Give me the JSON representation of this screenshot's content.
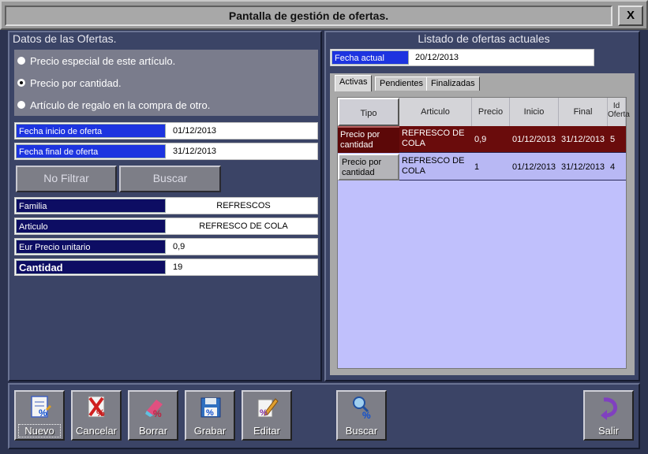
{
  "window": {
    "title": "Pantalla de gestión de ofertas.",
    "close_label": "X"
  },
  "left_panel": {
    "title": "Datos de las Ofertas.",
    "radios": [
      {
        "label": "Precio especial de este artículo.",
        "selected": false
      },
      {
        "label": "Precio por cantidad.",
        "selected": true
      },
      {
        "label": "Artículo de regalo en la compra de otro.",
        "selected": false
      }
    ],
    "fecha_inicio": {
      "label": "Fecha inicio de oferta",
      "value": "01/12/2013"
    },
    "fecha_final": {
      "label": "Fecha final de oferta",
      "value": "31/12/2013"
    },
    "btn_no_filtrar": "No Filtrar",
    "btn_buscar": "Buscar",
    "familia": {
      "label": "Familia",
      "value": "REFRESCOS"
    },
    "articulo": {
      "label": "Articulo",
      "value": "REFRESCO DE COLA"
    },
    "precio": {
      "label": "Eur Precio unitario",
      "value": "0,9"
    },
    "cantidad": {
      "label": "Cantidad",
      "value": "19"
    }
  },
  "right_panel": {
    "title": "Listado de ofertas actuales",
    "fecha_actual": {
      "label": "Fecha actual",
      "value": "20/12/2013"
    },
    "tabs": [
      "Activas",
      "Pendientes",
      "Finalizadas"
    ],
    "columns": [
      "Tipo",
      "Articulo",
      "Precio",
      "Inicio",
      "Final",
      "Id Oferta"
    ],
    "rows": [
      {
        "tipo": "Precio por cantidad",
        "articulo": "REFRESCO DE COLA",
        "precio": "0,9",
        "inicio": "01/12/2013",
        "final": "31/12/2013",
        "id": "5"
      },
      {
        "tipo": "Precio por cantidad",
        "articulo": "REFRESCO DE COLA",
        "precio": "1",
        "inicio": "01/12/2013",
        "final": "31/12/2013",
        "id": "4"
      }
    ]
  },
  "toolbar": {
    "nuevo": "Nuevo",
    "cancelar": "Cancelar",
    "borrar": "Borrar",
    "grabar": "Grabar",
    "editar": "Editar",
    "buscar": "Buscar",
    "salir": "Salir"
  },
  "colors": {
    "background": "#2c3350",
    "panel": "#3b4466",
    "selected_row": "#6a0c0c",
    "grid": "#c0c0fc",
    "label_blue": "#1d34e0",
    "label_navy": "#0d0d63"
  }
}
